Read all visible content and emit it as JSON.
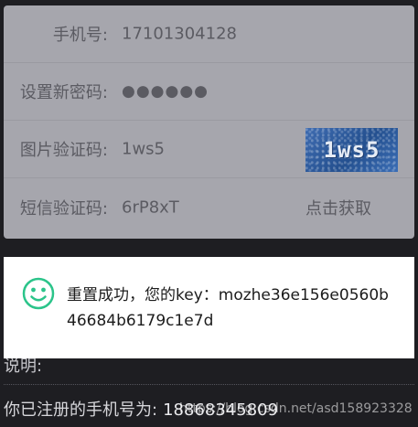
{
  "form": {
    "phone": {
      "label": "手机号:",
      "value": "17101304128"
    },
    "new_password": {
      "label": "设置新密码:",
      "value": "●●●●●●"
    },
    "image_captcha": {
      "label": "图片验证码:",
      "value": "1ws5",
      "image_text": "1ws5"
    },
    "sms_code": {
      "label": "短信验证码:",
      "value": "6rP8xT",
      "button_label": "点击获取"
    }
  },
  "toast": {
    "icon": "smiley-icon",
    "message": "重置成功，您的key：mozhe36e156e0560b46684b6179c1e7d",
    "icon_color": "#2bc48a"
  },
  "page": {
    "note_label": "说明:",
    "registered_phone_label": "你已注册的手机号为:",
    "registered_phone_value": "18868345809",
    "watermark": "https://blog.csdn.net/asd158923328"
  }
}
